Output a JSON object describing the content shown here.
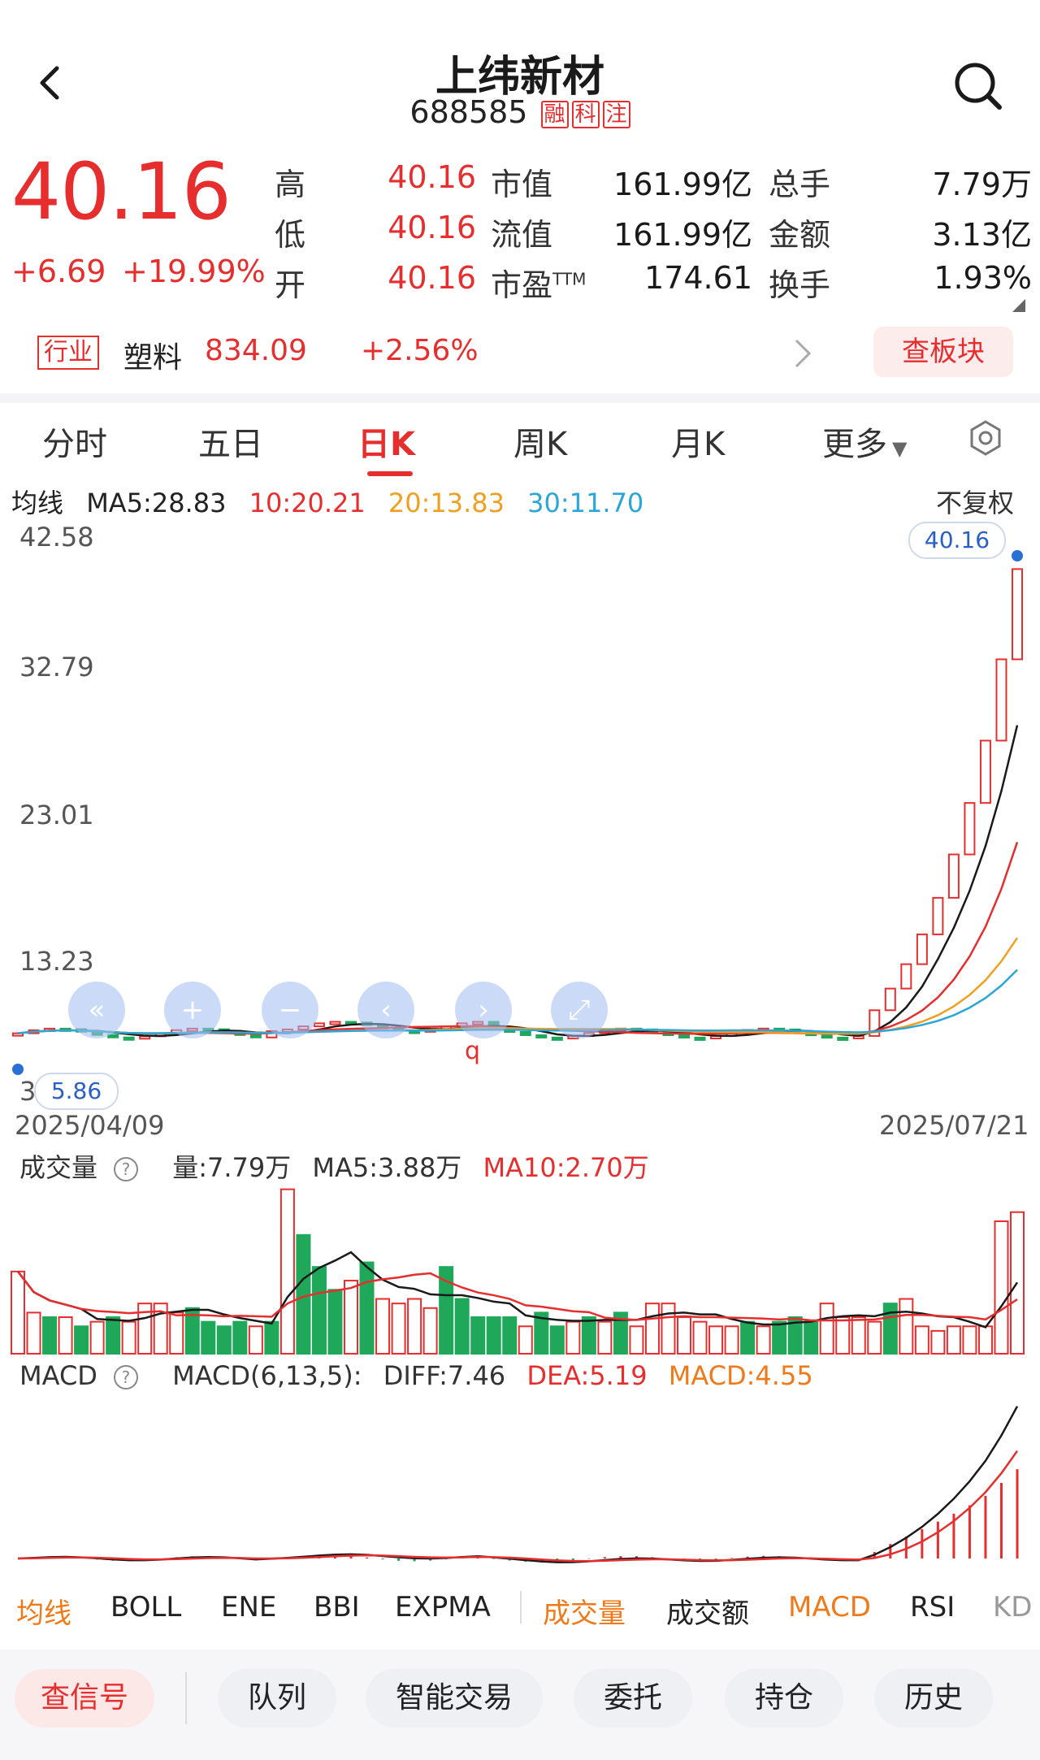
{
  "header": {
    "title": "上纬新材",
    "code": "688585",
    "tags": [
      "融",
      "科",
      "注"
    ]
  },
  "quote": {
    "price": "40.16",
    "change": "+6.69",
    "change_pct": "+19.99%",
    "rows": [
      {
        "l1": "高",
        "v1": "40.16",
        "l2": "市值",
        "v2": "161.99亿",
        "l3": "总手",
        "v3": "7.79万"
      },
      {
        "l1": "低",
        "v1": "40.16",
        "l2": "流值",
        "v2": "161.99亿",
        "l3": "金额",
        "v3": "3.13亿"
      },
      {
        "l1": "开",
        "v1": "40.16",
        "l2": "市盈",
        "l2sup": "TTM",
        "v2": "174.61",
        "l3": "换手",
        "v3": "1.93%"
      }
    ]
  },
  "industry": {
    "badge": "行业",
    "name": "塑料",
    "index": "834.09",
    "change": "+2.56%",
    "board_button": "查板块"
  },
  "tabs": [
    {
      "label": "分时"
    },
    {
      "label": "五日"
    },
    {
      "label": "日K"
    },
    {
      "label": "周K"
    },
    {
      "label": "月K"
    },
    {
      "label": "更多"
    }
  ],
  "ma": {
    "label": "均线",
    "ma5": "MA5:28.83",
    "ma10": "10:20.21",
    "ma20": "20:13.83",
    "ma30": "30:11.70",
    "adjust": "不复权"
  },
  "colors": {
    "up": "#e62e2e",
    "down": "#1fa85a",
    "ma5": "#1a1a1a",
    "ma10": "#e62e2e",
    "ma20": "#f0a020",
    "ma30": "#2ba6d8"
  },
  "price_axis": {
    "labels": [
      "42.58",
      "32.79",
      "23.01",
      "13.23",
      "3"
    ],
    "current_pill": "40.16",
    "low_pill": "5.86",
    "start_date": "2025/04/09",
    "end_date": "2025/07/21",
    "annotation": "q"
  },
  "zoom_buttons": [
    "«",
    "+",
    "−",
    "‹",
    "›",
    "⤢"
  ],
  "volume": {
    "label": "成交量",
    "vol": "量:7.79万",
    "ma5": "MA5:3.88万",
    "ma10": "MA10:2.70万"
  },
  "macd": {
    "label": "MACD",
    "params": "MACD(6,13,5):",
    "diff": "DIFF:7.46",
    "dea": "DEA:5.19",
    "macd": "MACD:4.55"
  },
  "indicator_tabs": [
    "均线",
    "BOLL",
    "ENE",
    "BBI",
    "EXPMA",
    "成交量",
    "成交额",
    "MACD",
    "RSI",
    "KD"
  ],
  "bottom_buttons": [
    "查信号",
    "队列",
    "智能交易",
    "委托",
    "持仓",
    "历史"
  ],
  "chart_data": [
    {
      "type": "candlestick",
      "title": "日K",
      "x_start": "2025/04/09",
      "x_end": "2025/07/21",
      "ylim": [
        3,
        42.58
      ],
      "y_ticks": [
        42.58,
        32.79,
        23.01,
        13.23
      ],
      "closes_tail": [
        7.6,
        9.2,
        11.0,
        13.2,
        15.9,
        19.1,
        22.9,
        27.5,
        33.5,
        40.16
      ],
      "series": [
        {
          "name": "MA5",
          "last": 28.83
        },
        {
          "name": "MA10",
          "last": 20.21
        },
        {
          "name": "MA20",
          "last": 13.83
        },
        {
          "name": "MA30",
          "last": 11.7
        }
      ]
    },
    {
      "type": "bar",
      "title": "成交量",
      "unit": "万",
      "values": [
        1.8,
        0.9,
        0.8,
        0.8,
        0.6,
        0.7,
        0.8,
        0.7,
        1.1,
        1.1,
        0.9,
        1.0,
        0.7,
        0.6,
        0.7,
        0.6,
        0.7,
        3.6,
        2.6,
        1.9,
        1.4,
        1.6,
        2.0,
        1.2,
        1.1,
        1.2,
        1.0,
        1.9,
        1.2,
        0.8,
        0.8,
        0.8,
        0.6,
        0.9,
        0.6,
        0.7,
        0.8,
        0.7,
        0.9,
        0.6,
        1.1,
        1.1,
        0.8,
        0.7,
        0.6,
        0.6,
        0.7,
        0.6,
        0.7,
        0.8,
        0.7,
        1.1,
        0.8,
        0.8,
        0.7,
        1.1,
        1.2,
        0.6,
        0.5,
        0.6,
        0.6,
        0.6,
        2.9,
        3.1
      ],
      "up": [
        1,
        1,
        0,
        1,
        0,
        1,
        0,
        1,
        1,
        1,
        1,
        0,
        0,
        0,
        0,
        1,
        0,
        1,
        0,
        0,
        0,
        1,
        0,
        1,
        1,
        1,
        1,
        0,
        0,
        0,
        0,
        0,
        1,
        0,
        0,
        1,
        0,
        1,
        0,
        1,
        1,
        1,
        1,
        1,
        1,
        1,
        0,
        1,
        0,
        0,
        0,
        1,
        1,
        1,
        1,
        0,
        1,
        1,
        1,
        1,
        1,
        1,
        1,
        1
      ],
      "series": [
        {
          "name": "MA5",
          "last": 3.88
        },
        {
          "name": "MA10",
          "last": 2.7
        }
      ]
    },
    {
      "type": "macd",
      "title": "MACD(6,13,5)",
      "series": [
        {
          "name": "DIFF",
          "last": 7.46
        },
        {
          "name": "DEA",
          "last": 5.19
        },
        {
          "name": "MACD",
          "last": 4.55
        }
      ]
    }
  ]
}
